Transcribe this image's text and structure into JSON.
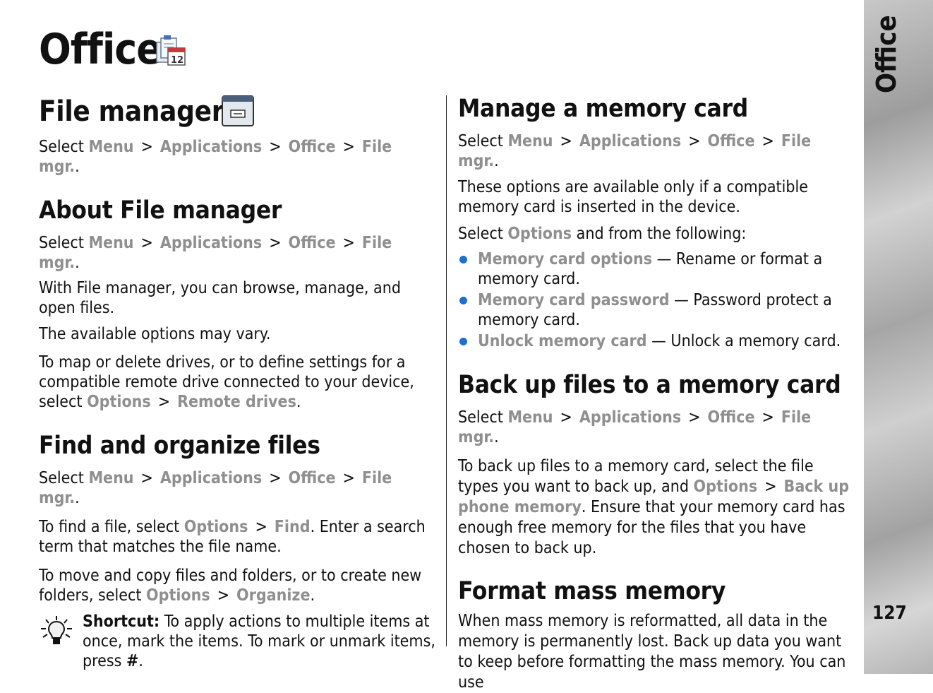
{
  "page_title": "Office",
  "sidebar_label": "Office",
  "page_number": "127",
  "path": {
    "select": "Select",
    "menu": "Menu",
    "applications": "Applications",
    "office": "Office",
    "file_mgr": "File mgr.",
    "gt": ">",
    "period": "."
  },
  "left": {
    "file_manager_heading": "File manager",
    "about_heading": "About File manager",
    "about_p1": "With File manager, you can browse, manage, and open files.",
    "about_p2": "The available options may vary.",
    "about_p3_pre": "To map or delete drives, or to define settings for a compatible remote drive connected to your device, select ",
    "options": "Options",
    "remote_drives": "Remote drives",
    "find_heading": "Find and organize files",
    "find_p1_pre": "To find a file, select ",
    "find": "Find",
    "find_p1_post": ". Enter a search term that matches the file name.",
    "find_p2_pre": "To move and copy files and folders, or to create new folders, select ",
    "organize": "Organize",
    "shortcut_label": "Shortcut:",
    "shortcut_text": " To apply actions to multiple items at once, mark the items. To mark or unmark items, press ",
    "shortcut_key": "#"
  },
  "right": {
    "manage_heading": "Manage a memory card",
    "manage_p1": "These options are available only if a compatible memory card is inserted in the device.",
    "manage_p2_pre": "Select ",
    "options": "Options",
    "manage_p2_post": " and from the following:",
    "items": [
      {
        "label": "Memory card options",
        "desc": " — Rename or format a memory card."
      },
      {
        "label": "Memory card password",
        "desc": " — Password protect a memory card."
      },
      {
        "label": "Unlock memory card",
        "desc": " — Unlock a memory card."
      }
    ],
    "backup_heading": "Back up files to a memory card",
    "backup_p_pre": "To back up files to a memory card, select the file types you want to back up, and ",
    "backup_phone_memory": "Back up phone memory",
    "backup_p_post": ". Ensure that your memory card has enough free memory for the files that you have chosen to back up.",
    "format_heading": "Format mass memory",
    "format_p": "When mass memory is reformatted, all data in the memory is permanently lost. Back up data you want to keep before formatting the mass memory. You can use"
  }
}
